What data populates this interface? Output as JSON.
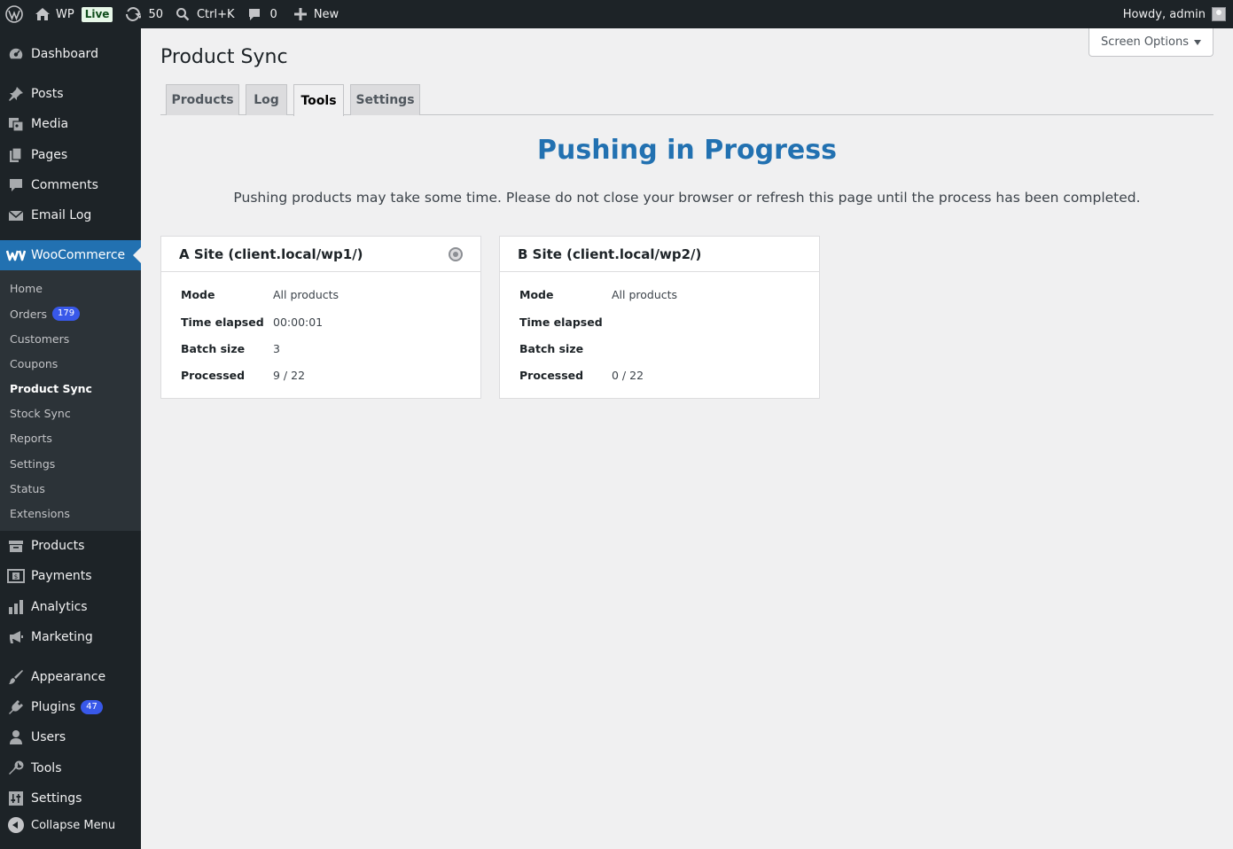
{
  "adminbar": {
    "site_name": "WP",
    "live_badge": "Live",
    "updates_count": "50",
    "search_shortcut": "Ctrl+K",
    "comments_count": "0",
    "new_label": "New",
    "greeting": "Howdy, admin"
  },
  "sidebar": {
    "dashboard": "Dashboard",
    "posts": "Posts",
    "media": "Media",
    "pages": "Pages",
    "comments": "Comments",
    "email_log": "Email Log",
    "woocommerce": "WooCommerce",
    "woo_submenu": {
      "home": "Home",
      "orders": "Orders",
      "orders_badge": "179",
      "customers": "Customers",
      "coupons": "Coupons",
      "product_sync": "Product Sync",
      "stock_sync": "Stock Sync",
      "reports": "Reports",
      "settings": "Settings",
      "status": "Status",
      "extensions": "Extensions"
    },
    "products": "Products",
    "payments": "Payments",
    "analytics": "Analytics",
    "marketing": "Marketing",
    "appearance": "Appearance",
    "plugins": "Plugins",
    "plugins_badge": "47",
    "users": "Users",
    "tools": "Tools",
    "settings": "Settings",
    "collapse": "Collapse Menu"
  },
  "screen_options": "Screen Options",
  "page_title": "Product Sync",
  "tabs": [
    "Products",
    "Log",
    "Tools",
    "Settings"
  ],
  "active_tab": "Tools",
  "progress": {
    "heading": "Pushing in Progress",
    "notice": "Pushing products may take some time. Please do not close your browser or refresh this page until the process has been completed."
  },
  "sites": [
    {
      "title": "A Site (client.local/wp1/)",
      "mode_label": "Mode",
      "mode": "All products",
      "time_label": "Time elapsed",
      "time": "00:00:01",
      "batch_label": "Batch size",
      "batch": "3",
      "processed_label": "Processed",
      "processed": "9 / 22"
    },
    {
      "title": "B Site (client.local/wp2/)",
      "mode_label": "Mode",
      "mode": "All products",
      "time_label": "Time elapsed",
      "time": "",
      "batch_label": "Batch size",
      "batch": "",
      "processed_label": "Processed",
      "processed": "0 / 22"
    }
  ],
  "colors": {
    "adminbar_bg": "#1d2327",
    "accent": "#2271b1",
    "heading": "#2271b1",
    "page_bg": "#f0f0f1"
  }
}
